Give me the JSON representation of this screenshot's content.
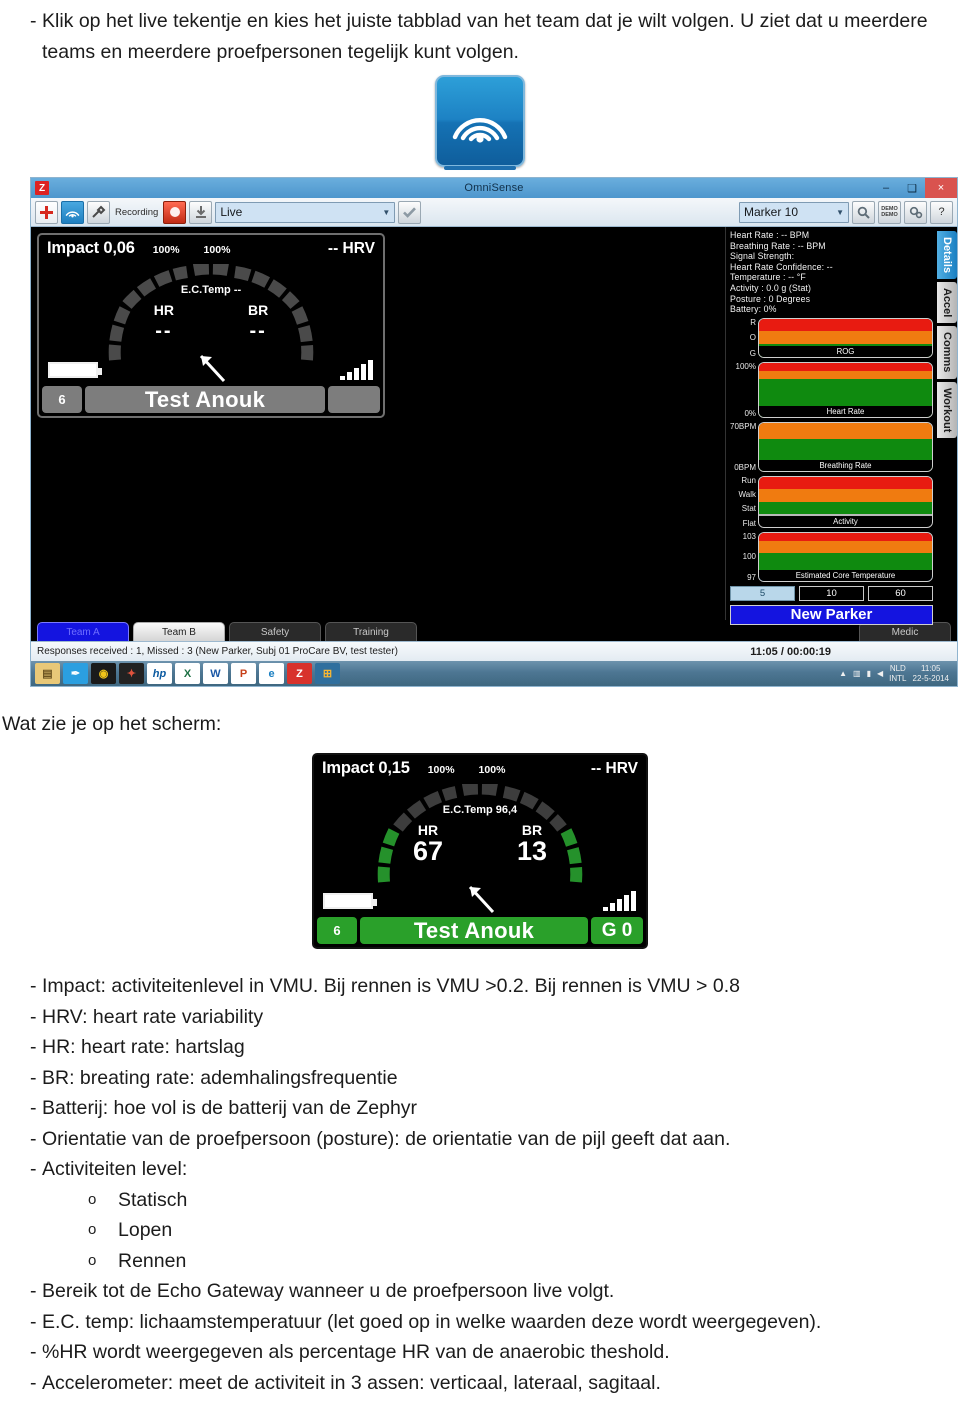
{
  "intro_bullets": [
    "Klik op het live tekentje en kies het juiste tabblad van het team dat je wilt volgen. U ziet dat u meerdere teams en meerdere proefpersonen tegelijk kunt volgen."
  ],
  "app_icon": {
    "name": "live-wifi-icon"
  },
  "section_label": "Wat zie je op het scherm:",
  "omnisense": {
    "window_title": "OmniSense",
    "app_badge": "Z",
    "window_controls": {
      "minimize": "–",
      "maximize": "❑",
      "close": "×"
    },
    "toolbar": {
      "add_label": "+",
      "wifi_label": "",
      "tools_label": "",
      "recording_label": "Recording",
      "record_label": "",
      "download_label": "",
      "mode_value": "Live",
      "apply_label": "✓",
      "marker_value": "Marker 10",
      "search_label": "",
      "demo_label_top": "DEMO",
      "demo_label_bottom": "DEMO",
      "settings_label": "",
      "help_label": "?"
    },
    "subject_tile": {
      "impact": "Impact 0,06",
      "pct_left": "100%",
      "pct_right": "100%",
      "hrv": "-- HRV",
      "ec_temp": "E.C.Temp --",
      "hr_label": "HR",
      "hr_value": "--",
      "br_label": "BR",
      "br_value": "--",
      "device_number": "6",
      "subject_name": "Test Anouk",
      "gateway": ""
    },
    "details": {
      "stats": [
        "Heart Rate : -- BPM",
        "Breathing Rate : -- BPM",
        "Signal Strength:",
        "Heart Rate Confidence: --",
        "Temperature : -- °F",
        "Activity : 0.0 g (Stat)",
        "Posture : 0 Degrees",
        "Battery: 0%"
      ],
      "strips": [
        {
          "caption": "ROG",
          "ylabels": [
            "R",
            "O",
            "G"
          ]
        },
        {
          "caption": "Heart Rate",
          "ylabels": [
            "100%",
            "0%"
          ]
        },
        {
          "caption": "Breathing Rate",
          "ylabels": [
            "70BPM",
            "0BPM"
          ]
        },
        {
          "caption": "Activity",
          "ylabels": [
            "Run",
            "Walk",
            "Stat",
            "Flat"
          ]
        },
        {
          "caption": "Estimated Core Temperature",
          "ylabels": [
            "103",
            "100",
            "97"
          ]
        }
      ],
      "time_buttons": [
        "5",
        "10",
        "60"
      ],
      "time_selected": "5",
      "new_parker_label": "New Parker"
    },
    "side_tabs": [
      {
        "label": "Details",
        "selected": true
      },
      {
        "label": "Accel",
        "selected": false
      },
      {
        "label": "Comms",
        "selected": false
      },
      {
        "label": "Workout",
        "selected": false
      }
    ],
    "team_tabs": [
      {
        "label": "Team A",
        "state": "selected"
      },
      {
        "label": "Team B",
        "state": "light"
      },
      {
        "label": "Safety",
        "state": "dark"
      },
      {
        "label": "Training",
        "state": "dark"
      },
      {
        "label": "Medic",
        "state": "dark"
      }
    ],
    "status_bar": {
      "message": "Responses received : 1, Missed : 3 (New Parker, Subj 01 ProCare BV, test tester)",
      "clock": "11:05 / 00:00:19"
    },
    "taskbar": {
      "icons": [
        "folder-icon",
        "pen-icon",
        "disc-icon",
        "puzzle-icon",
        "hp-icon",
        "excel-icon",
        "word-icon",
        "powerpoint-icon",
        "internet-explorer-icon",
        "zephyr-icon",
        "windows-icon"
      ],
      "tray_language_top": "NLD",
      "tray_language_bottom": "INTL",
      "tray_time": "11:05",
      "tray_date": "22-5-2014"
    }
  },
  "example_tile": {
    "impact": "Impact 0,15",
    "pct_left": "100%",
    "pct_right": "100%",
    "hrv": "-- HRV",
    "ec_temp": "E.C.Temp 96,4",
    "hr_label": "HR",
    "hr_value": "67",
    "br_label": "BR",
    "br_value": "13",
    "device_number": "6",
    "subject_name": "Test Anouk",
    "gateway": "G 0"
  },
  "legend_bullets": [
    "Impact: activiteitenlevel in VMU. Bij rennen is VMU >0.2. Bij rennen is VMU > 0.8",
    "HRV: heart rate variability",
    "HR: heart rate: hartslag",
    "BR: breating rate: ademhalingsfrequentie",
    "Batterij: hoe vol is de batterij van de Zephyr",
    "Orientatie van de proefpersoon (posture): de orientatie van de pijl geeft dat aan.",
    "Activiteiten level:"
  ],
  "activity_sub_bullets": [
    "Statisch",
    "Lopen",
    "Rennen"
  ],
  "legend_bullets_tail": [
    "Bereik tot de Echo Gateway wanneer u de proefpersoon live volgt.",
    "E.C. temp: lichaamstemperatuur (let goed op in welke waarden deze wordt weergegeven).",
    "%HR wordt weergegeven als percentage HR van de anaerobic theshold.",
    "Accelerometer: meet de activiteit in 3 assen: verticaal, lateraal, sagitaal."
  ],
  "colors": {
    "accent_blue": "#1a7fc1",
    "selected_tab_blue": "#1414e0",
    "record_red": "#c02c16",
    "green": "#2aa02a",
    "band_red": "#e81b11",
    "band_orange": "#f07b10",
    "band_green": "#0f8a0f"
  }
}
